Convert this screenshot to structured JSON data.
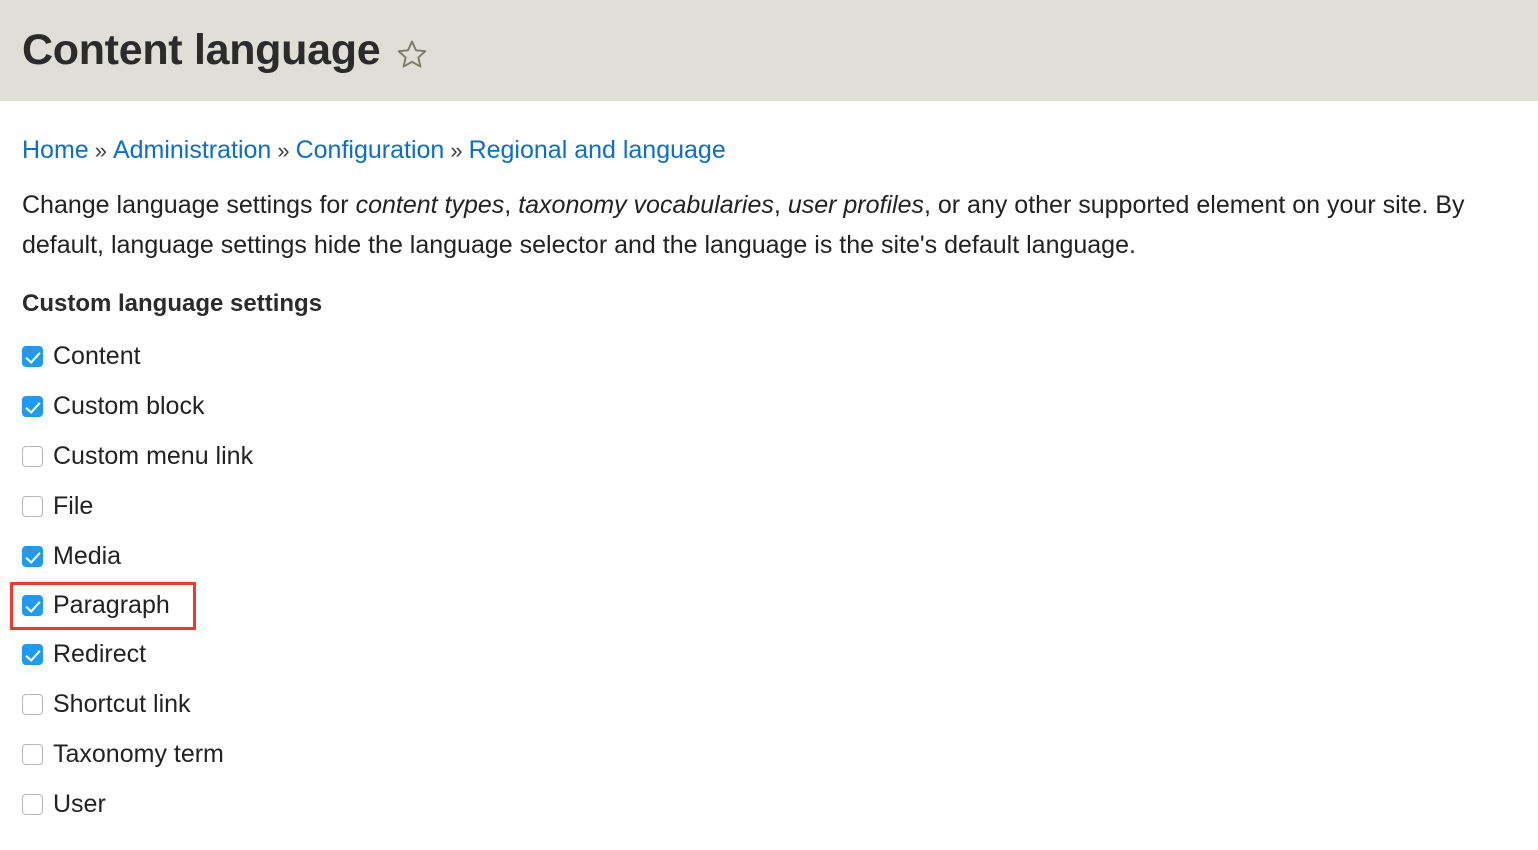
{
  "header": {
    "title": "Content language",
    "star_icon": "star-outline-icon",
    "background_color": "#dfdfd8"
  },
  "breadcrumb": {
    "separator": "»",
    "items": [
      {
        "label": "Home"
      },
      {
        "label": "Administration"
      },
      {
        "label": "Configuration"
      },
      {
        "label": "Regional and language"
      }
    ]
  },
  "description": {
    "part1": "Change language settings for ",
    "em1": "content types",
    "part2": ", ",
    "em2": "taxonomy vocabularies",
    "part3": ", ",
    "em3": "user profiles",
    "part4": ", or any other supported element on your site. By default, language settings hide the language selector and the language is the site's default language."
  },
  "settings": {
    "heading": "Custom language settings",
    "items": [
      {
        "label": "Content",
        "checked": true,
        "highlighted": false
      },
      {
        "label": "Custom block",
        "checked": true,
        "highlighted": false
      },
      {
        "label": "Custom menu link",
        "checked": false,
        "highlighted": false
      },
      {
        "label": "File",
        "checked": false,
        "highlighted": false
      },
      {
        "label": "Media",
        "checked": true,
        "highlighted": false
      },
      {
        "label": "Paragraph",
        "checked": true,
        "highlighted": true
      },
      {
        "label": "Redirect",
        "checked": true,
        "highlighted": false
      },
      {
        "label": "Shortcut link",
        "checked": false,
        "highlighted": false
      },
      {
        "label": "Taxonomy term",
        "checked": false,
        "highlighted": false
      },
      {
        "label": "User",
        "checked": false,
        "highlighted": false
      }
    ]
  },
  "colors": {
    "checkbox_checked": "#1e9af0",
    "link": "#0c6ec4",
    "highlight_box": "#f4382b",
    "star": "#7a7a68"
  }
}
